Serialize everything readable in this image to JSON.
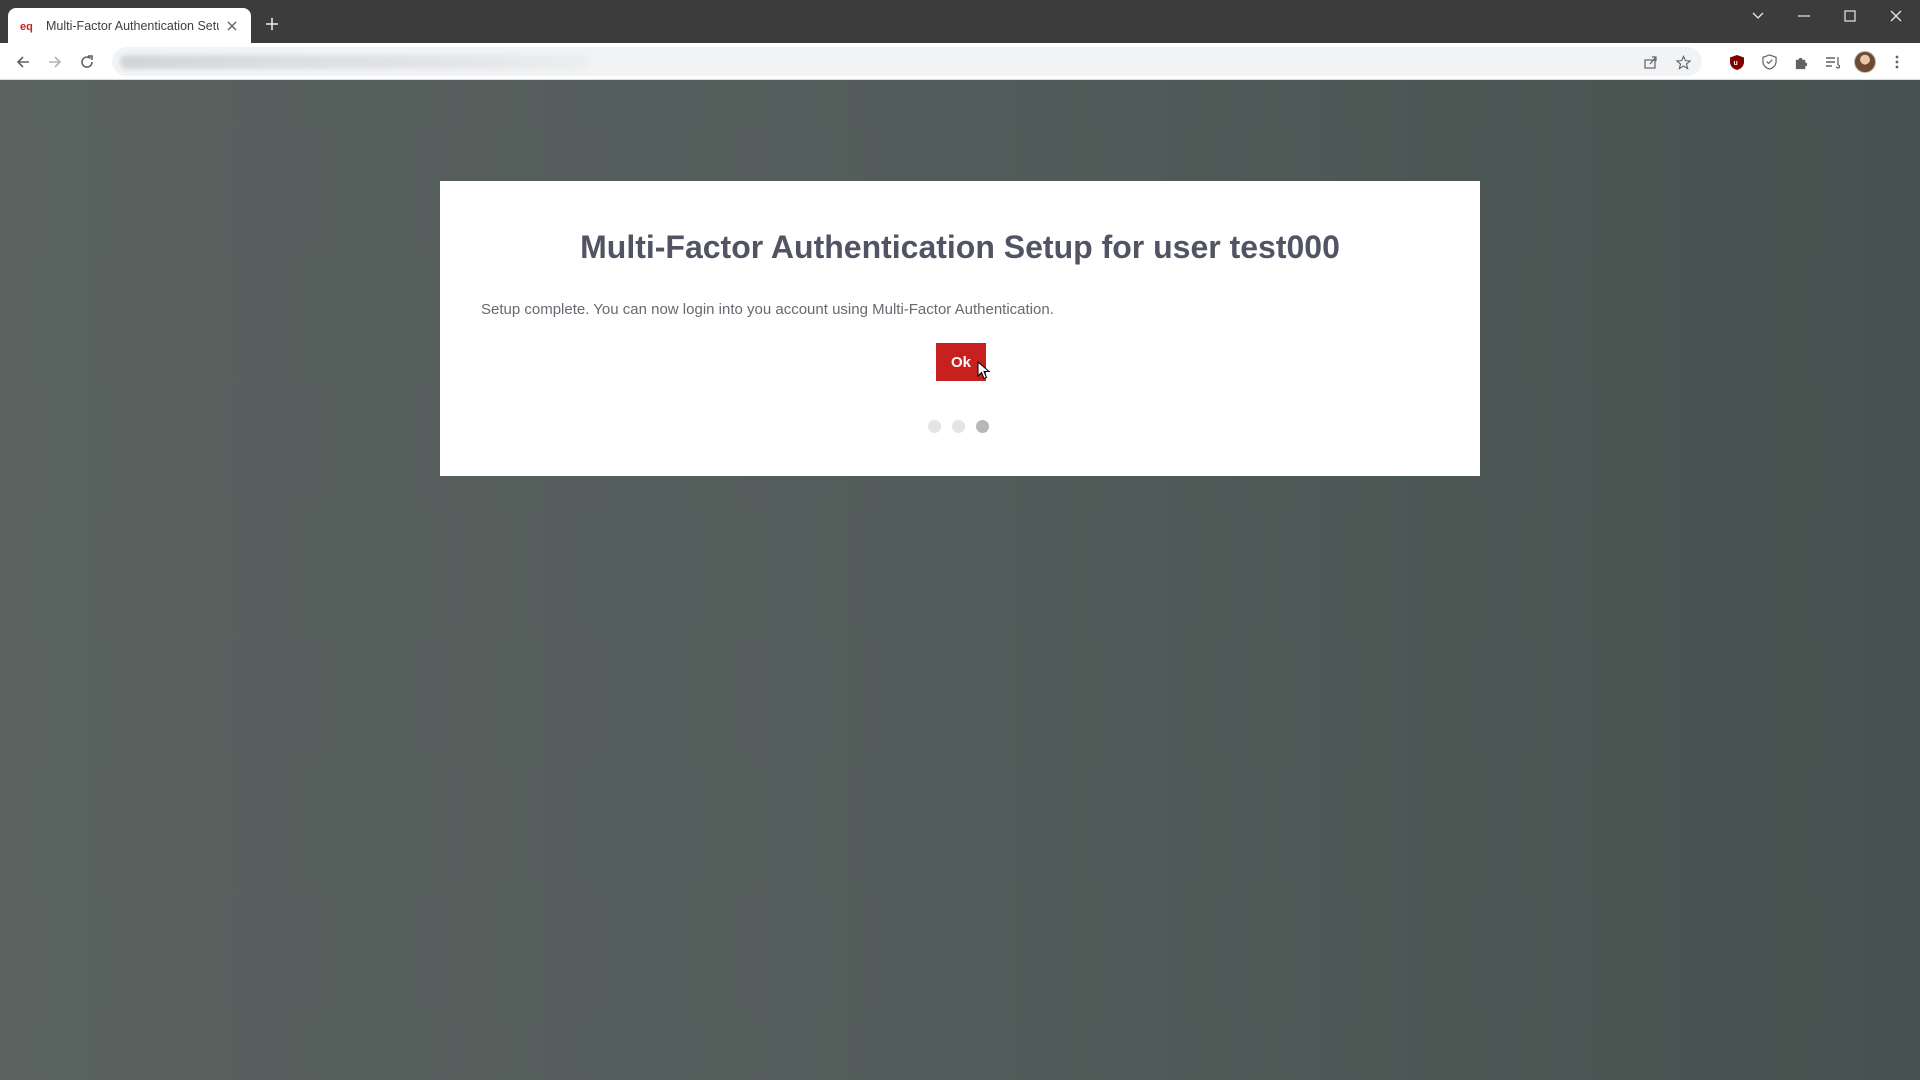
{
  "browser": {
    "tab": {
      "title": "Multi-Factor Authentication Setu",
      "favicon": "eq-logo-icon"
    },
    "nav": [
      "back-icon",
      "forward-icon",
      "reload-icon"
    ],
    "omnibox_icons": [
      "share-icon",
      "bookmark-star-icon"
    ],
    "extensions": [
      "ublock-shield-icon",
      "privacy-shield-icon",
      "puzzle-icon",
      "reading-list-icon",
      "avatar",
      "kebab-menu-icon"
    ],
    "window_controls": [
      "tab-search-icon",
      "minimize-icon",
      "maximize-icon",
      "close-icon"
    ]
  },
  "page": {
    "title": "Multi-Factor Authentication Setup for user test000",
    "message": "Setup complete. You can now login into you account using Multi-Factor Authentication.",
    "ok_label": "Ok",
    "steps": {
      "total": 3,
      "current": 3
    }
  },
  "colors": {
    "accent": "#c8201f",
    "backdrop": "#4c5656",
    "title": "#525464"
  }
}
